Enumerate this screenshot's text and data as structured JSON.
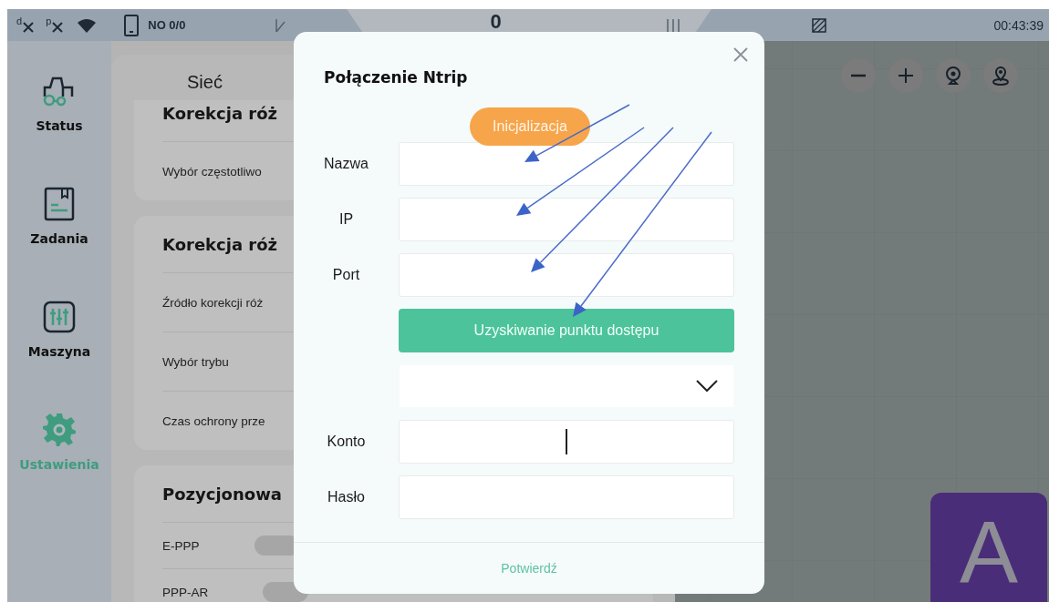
{
  "status_bar": {
    "indicators": [
      {
        "label": "d"
      },
      {
        "label": "p"
      }
    ],
    "storage": "NO 0/0",
    "center": "0",
    "time": "00:43:39"
  },
  "sidebar": {
    "items": [
      {
        "label": "Status",
        "selected": false
      },
      {
        "label": "Zadania",
        "selected": false
      },
      {
        "label": "Maszyna",
        "selected": false
      },
      {
        "label": "Ustawienia",
        "selected": true
      }
    ]
  },
  "settings_panel": {
    "title": "Sieć",
    "cards": [
      {
        "title": "Korekcja róż",
        "rows": [
          {
            "label": "Wybór częstotliwo",
            "kind": "text"
          }
        ]
      },
      {
        "title": "Korekcja róż",
        "rows": [
          {
            "label": "Źródło korekcji róż",
            "kind": "text"
          },
          {
            "label": "Wybór trybu",
            "kind": "text"
          },
          {
            "label": "Czas ochrony prze",
            "kind": "text"
          }
        ]
      },
      {
        "title": "Pozycjonowa",
        "rows": [
          {
            "label": "E-PPP",
            "kind": "toggle",
            "on": false
          },
          {
            "label": "PPP-AR",
            "kind": "toggle",
            "on": false
          }
        ]
      }
    ]
  },
  "map": {
    "mode_tile": "A"
  },
  "dialog": {
    "title": "Połączenie Ntrip",
    "toast": "Inicjalizacja",
    "fields": [
      {
        "kind": "input",
        "label": "Nazwa",
        "focused": false
      },
      {
        "kind": "input",
        "label": "IP",
        "focused": false
      },
      {
        "kind": "input",
        "label": "Port",
        "focused": false
      },
      {
        "kind": "button",
        "label": "Uzyskiwanie punktu dostępu"
      },
      {
        "kind": "select"
      },
      {
        "kind": "input",
        "label": "Konto",
        "focused": true
      },
      {
        "kind": "input",
        "label": "Hasło",
        "focused": false
      }
    ],
    "confirm": "Potwierdź"
  }
}
